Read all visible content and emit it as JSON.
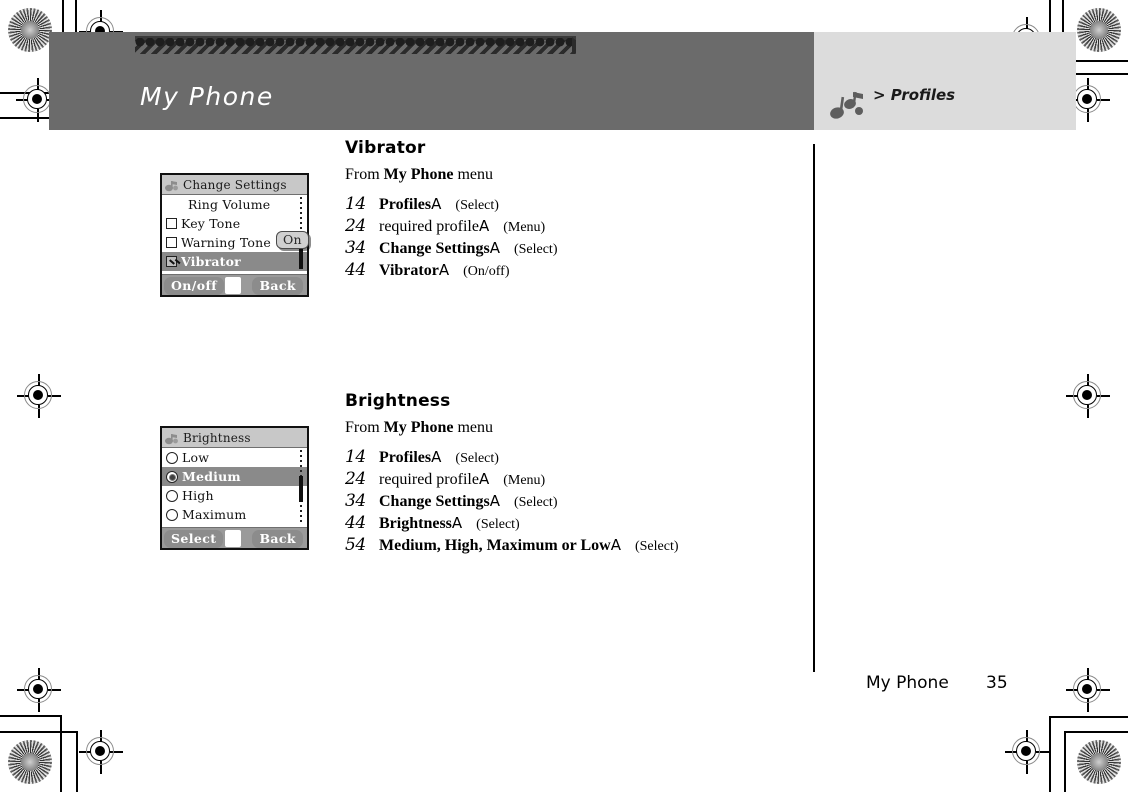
{
  "banner": {
    "title": "My Phone",
    "breadcrumb": "> Profiles",
    "breadcrumb_icon": "musical-notes-icon"
  },
  "footer": {
    "label": "My Phone",
    "page_number": "35"
  },
  "sections": [
    {
      "heading": "Vibrator",
      "from_prefix": "From ",
      "from_bold": "My Phone",
      "from_suffix": " menu",
      "steps": [
        {
          "num": "1",
          "marker": "4",
          "text": "Profiles",
          "bold": true,
          "arrow": "A",
          "action": "(Select)"
        },
        {
          "num": "2",
          "marker": "4",
          "text": "required profile",
          "bold": false,
          "arrow": "A",
          "action": "(Menu)"
        },
        {
          "num": "3",
          "marker": "4",
          "text": "Change Settings",
          "bold": true,
          "arrow": "A",
          "action": "(Select)"
        },
        {
          "num": "4",
          "marker": "4",
          "text": "Vibrator",
          "bold": true,
          "arrow": "A",
          "action": "(On/off)"
        }
      ]
    },
    {
      "heading": "Brightness",
      "from_prefix": "From ",
      "from_bold": "My Phone",
      "from_suffix": " menu",
      "steps": [
        {
          "num": "1",
          "marker": "4",
          "text": "Profiles",
          "bold": true,
          "arrow": "A",
          "action": "(Select)"
        },
        {
          "num": "2",
          "marker": "4",
          "text": "required profile",
          "bold": false,
          "arrow": "A",
          "action": "(Menu)"
        },
        {
          "num": "3",
          "marker": "4",
          "text": "Change Settings",
          "bold": true,
          "arrow": "A",
          "action": "(Select)"
        },
        {
          "num": "4",
          "marker": "4",
          "text": "Brightness",
          "bold": true,
          "arrow": "A",
          "action": "(Select)"
        },
        {
          "num": "5",
          "marker": "4",
          "text": "Medium, High, Maximum or Low",
          "bold": true,
          "arrow": "A",
          "action": "(Select)"
        }
      ]
    }
  ],
  "screens": [
    {
      "title": "Change Settings",
      "title_icon": "profile-settings-icon",
      "rows": [
        {
          "label": "Ring Volume",
          "control": "none",
          "selected": false
        },
        {
          "label": "Key Tone",
          "control": "checkbox",
          "checked": false,
          "selected": false
        },
        {
          "label": "Warning Tone",
          "control": "checkbox",
          "checked": false,
          "selected": false
        },
        {
          "label": "Vibrator",
          "control": "checkbox",
          "checked": true,
          "selected": true
        }
      ],
      "tooltip": "On",
      "softkey_left": "On/off",
      "softkey_right": "Back"
    },
    {
      "title": "Brightness",
      "title_icon": "profile-settings-icon",
      "rows": [
        {
          "label": "Low",
          "control": "radio",
          "checked": false,
          "selected": false
        },
        {
          "label": "Medium",
          "control": "radio",
          "checked": true,
          "selected": true
        },
        {
          "label": "High",
          "control": "radio",
          "checked": false,
          "selected": false
        },
        {
          "label": "Maximum",
          "control": "radio",
          "checked": false,
          "selected": false
        }
      ],
      "tooltip": null,
      "softkey_left": "Select",
      "softkey_right": "Back"
    }
  ],
  "colors": {
    "banner_left": "#6b6b6b",
    "banner_right": "#dcdcdc",
    "screen_select": "#8a8a8a",
    "screen_titlebar": "#c8c8c8"
  }
}
